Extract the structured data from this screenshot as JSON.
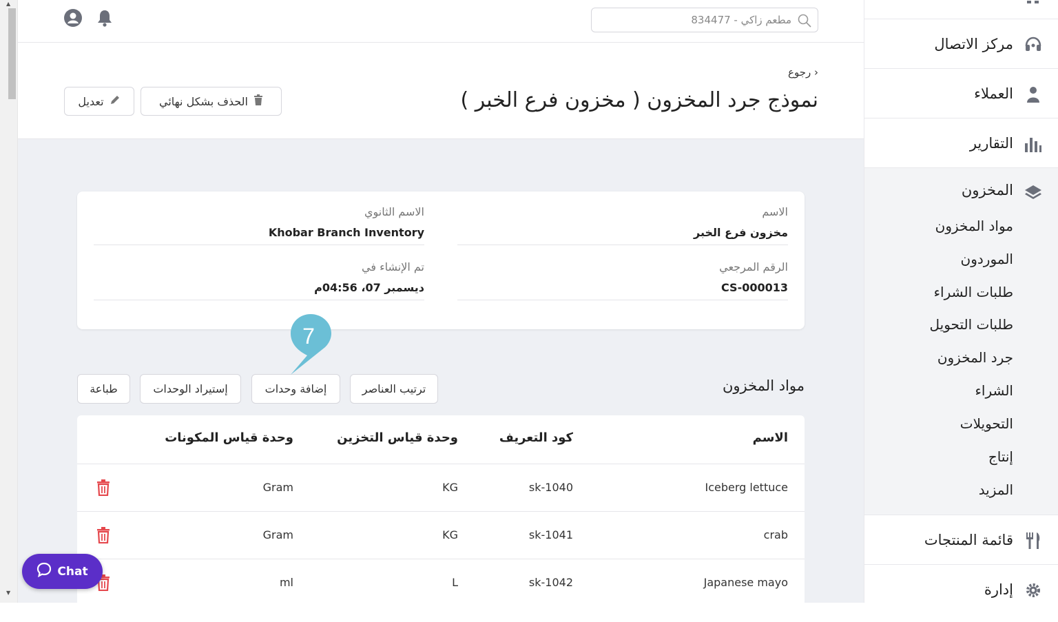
{
  "topbar": {
    "search_text": "مطعم زاكي - 834477",
    "icons": [
      "user-circle-icon",
      "bell-icon",
      "search-icon"
    ]
  },
  "header": {
    "back_label": "رجوع",
    "title": "نموذج جرد المخزون ( مخزون فرع الخبر )",
    "delete_label": "الحذف بشكل نهائي",
    "edit_label": "تعديل"
  },
  "details": {
    "name_label": "الاسم",
    "name_value": "مخزون فرع الخبر",
    "secondary_name_label": "الاسم الثانوي",
    "secondary_name_value": "Khobar Branch Inventory",
    "reference_label": "الرقم المرجعي",
    "reference_value": "CS-000013",
    "created_label": "تم الإنشاء في",
    "created_value": "ديسمبر 07، 04:56م"
  },
  "items_section": {
    "title": "مواد المخزون",
    "sort_label": "ترتيب العناصر",
    "add_units_label": "إضافة وحدات",
    "import_units_label": "إستيراد الوحدات",
    "print_label": "طباعة",
    "step_number": "7",
    "columns": [
      "الاسم",
      "كود التعريف",
      "وحدة قياس التخزين",
      "وحدة قياس المكونات"
    ],
    "rows": [
      {
        "name": "Iceberg lettuce",
        "sku": "sk-1040",
        "storage_unit": "KG",
        "ingredient_unit": "Gram"
      },
      {
        "name": "crab",
        "sku": "sk-1041",
        "storage_unit": "KG",
        "ingredient_unit": "Gram"
      },
      {
        "name": "Japanese mayo",
        "sku": "sk-1042",
        "storage_unit": "L",
        "ingredient_unit": "ml"
      }
    ]
  },
  "sidebar": {
    "items": [
      {
        "label": "مركز الاتصال",
        "icon": "headset-icon"
      },
      {
        "label": "العملاء",
        "icon": "customers-icon"
      },
      {
        "label": "التقارير",
        "icon": "bar-chart-icon"
      }
    ],
    "inventory_group": {
      "label": "المخزون",
      "icon": "layers-icon",
      "sub_items": [
        "مواد المخزون",
        "الموردون",
        "طلبات الشراء",
        "طلبات التحويل",
        "جرد المخزون",
        "الشراء",
        "التحويلات",
        "إنتاج",
        "المزيد"
      ]
    },
    "menu_item": {
      "label": "قائمة المنتجات",
      "icon": "fork-knife-icon"
    },
    "admin_item": {
      "label": "إدارة",
      "icon": "gear-icon"
    }
  },
  "chat": {
    "label": "Chat",
    "icon": "chat-bubble-icon"
  },
  "colors": {
    "accent": "#5b2ec8",
    "pin": "#6bbfd6",
    "danger": "#e5484d",
    "background": "#eef0f4"
  }
}
